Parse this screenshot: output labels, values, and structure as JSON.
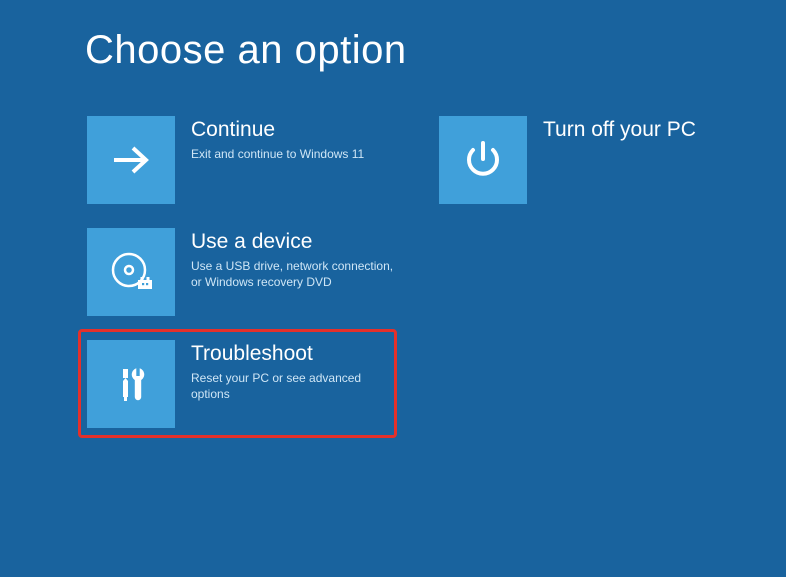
{
  "page": {
    "title": "Choose an option"
  },
  "options": {
    "continue": {
      "title": "Continue",
      "desc": "Exit and continue to Windows 11"
    },
    "turnoff": {
      "title": "Turn off your PC",
      "desc": ""
    },
    "usedevice": {
      "title": "Use a device",
      "desc": "Use a USB drive, network connection, or Windows recovery DVD"
    },
    "troubleshoot": {
      "title": "Troubleshoot",
      "desc": "Reset your PC or see advanced options"
    }
  },
  "highlight": {
    "target": "troubleshoot"
  }
}
